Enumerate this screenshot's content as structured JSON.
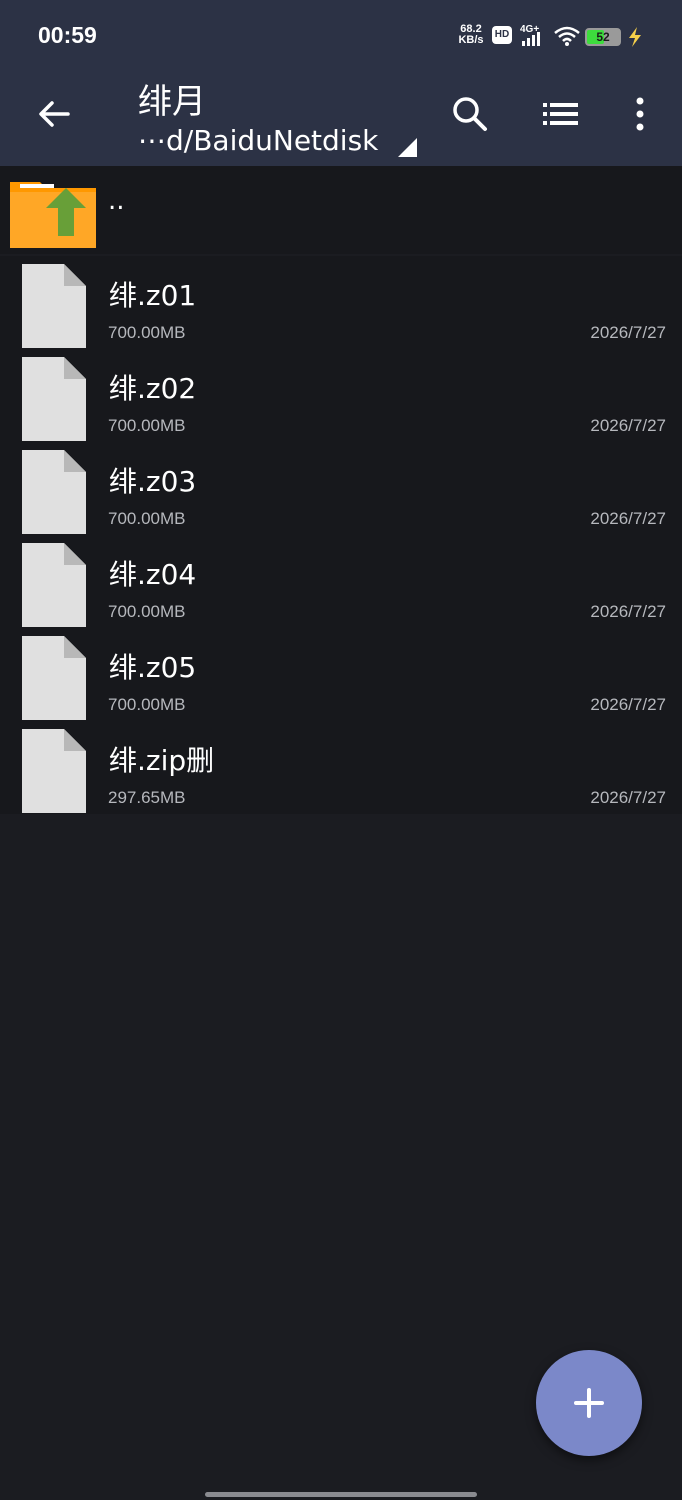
{
  "status_bar": {
    "time": "00:59",
    "net_speed_value": "68.2",
    "net_speed_unit": "KB/s",
    "hd": "HD",
    "signal_label": "4G+",
    "battery_level": "52",
    "battery_fraction": 0.52,
    "battery_color": "#3ddc3d"
  },
  "toolbar": {
    "title": "绯月",
    "path": "⋯d/BaiduNetdisk",
    "back_icon": "arrow-left-icon",
    "search_icon": "search-icon",
    "view_icon": "list-view-icon",
    "more_icon": "more-vert-icon"
  },
  "parent_dir": {
    "label": ".."
  },
  "files": [
    {
      "name": "绯.z01",
      "size": "700.00MB",
      "date": "2026/7/27"
    },
    {
      "name": "绯.z02",
      "size": "700.00MB",
      "date": "2026/7/27"
    },
    {
      "name": "绯.z03",
      "size": "700.00MB",
      "date": "2026/7/27"
    },
    {
      "name": "绯.z04",
      "size": "700.00MB",
      "date": "2026/7/27"
    },
    {
      "name": "绯.z05",
      "size": "700.00MB",
      "date": "2026/7/27"
    },
    {
      "name": "绯.zip删",
      "size": "297.65MB",
      "date": "2026/7/27"
    }
  ],
  "fab": {
    "icon": "plus-icon",
    "color": "#7b88c9"
  },
  "colors": {
    "toolbar_bg": "#2c3245",
    "list_bg": "#17181c",
    "page_bg": "#1b1c21",
    "folder": "#ff9800",
    "arrow": "#689f38"
  }
}
